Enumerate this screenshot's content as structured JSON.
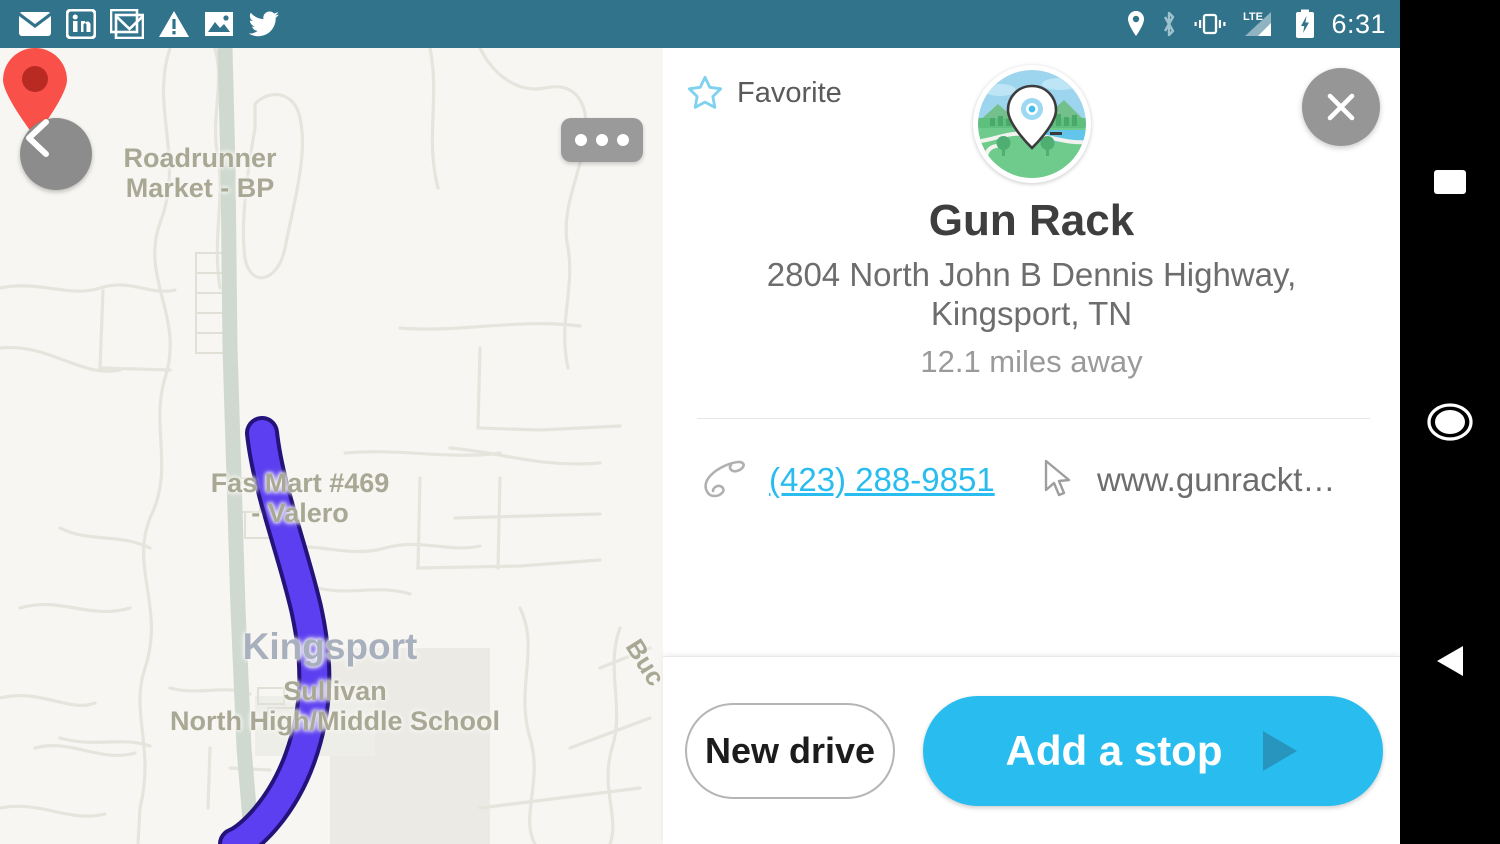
{
  "statusbar": {
    "time": "6:31",
    "left_icons": [
      "envelope-icon",
      "linkedin-icon",
      "gmail-stack-icon",
      "warning-icon",
      "image-icon",
      "twitter-icon"
    ],
    "right_icons": [
      "location-icon",
      "bluetooth-icon",
      "vibrate-icon",
      "lte-signal-icon",
      "battery-charging-icon"
    ],
    "network_label": "LTE",
    "bg_color": "#31738a"
  },
  "map": {
    "background_color": "#f7f6f2",
    "route_color": "#5b3ff0",
    "route_outline_color": "#24137a",
    "marker_color": "#f9514a",
    "marker_center_color": "#b82a22",
    "highway_color": "#cfd9cf",
    "labels": {
      "roadrunner": "Roadrunner\nMarket - BP",
      "roadrunner_line1": "Roadrunner",
      "roadrunner_line2": "Market - BP",
      "fasmart_line1": "Fas Mart #469",
      "fasmart_line2": "- Valero",
      "city": "Kingsport",
      "school_line1": "Sullivan",
      "school_line2": "North High/Middle School",
      "street_rotated": "Buc"
    },
    "back_button": "back-chevron-icon",
    "more_button": "overflow-menu-icon"
  },
  "panel": {
    "favorite_label": "Favorite",
    "favorite_icon": "star-outline-icon",
    "favorite_icon_color": "#7fd2ef",
    "close_icon": "close-x-icon",
    "avatar_icon": "map-pin-avatar",
    "title": "Gun Rack",
    "address_line1": "2804 North John B Dennis Highway,",
    "address_line2": "Kingsport, TN",
    "distance": "12.1 miles away",
    "phone": {
      "icon": "phone-icon",
      "number": "(423) 288-9851",
      "color": "#29bdef"
    },
    "website": {
      "icon": "cursor-arrow-icon",
      "url": "www.gunrackt…"
    }
  },
  "actions": {
    "new_drive_label": "New drive",
    "add_stop_label": "Add a stop",
    "add_stop_icon": "play-triangle-icon",
    "add_stop_color": "#29bdef"
  },
  "navbar": {
    "recents": "square-recents-icon",
    "home": "circle-home-icon",
    "back": "triangle-back-icon"
  }
}
